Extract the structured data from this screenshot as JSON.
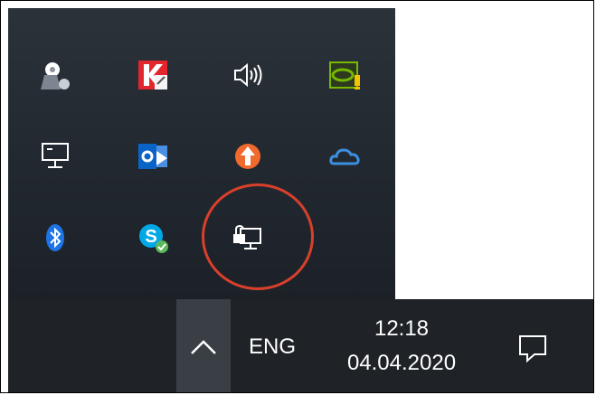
{
  "tray_flyout": {
    "icons": [
      {
        "name": "sound-speaker-icon",
        "row": 0
      },
      {
        "name": "kaspersky-icon",
        "row": 0
      },
      {
        "name": "volume-icon",
        "row": 0
      },
      {
        "name": "nvidia-icon",
        "row": 0
      },
      {
        "name": "network-icon",
        "row": 1
      },
      {
        "name": "outlook-icon",
        "row": 1
      },
      {
        "name": "update-arrow-icon",
        "row": 1
      },
      {
        "name": "onedrive-icon",
        "row": 1
      },
      {
        "name": "bluetooth-icon",
        "row": 2
      },
      {
        "name": "skype-icon",
        "row": 2
      },
      {
        "name": "unlocked-computer-icon",
        "row": 2
      }
    ],
    "highlighted_icon": "unlocked-computer-icon",
    "highlight_color": "#d9402b"
  },
  "taskbar": {
    "language": "ENG",
    "time": "12:18",
    "date": "04.04.2020"
  },
  "colors": {
    "flyout_bg": "#262b32",
    "taskbar_bg": "#1f2328",
    "chevron_bg": "#3a3f45",
    "kaspersky_red": "#e3262d",
    "nvidia_green": "#76b900",
    "outlook_blue": "#0a64c8",
    "update_orange": "#f06a2e",
    "onedrive_blue": "#3c8fe0",
    "bluetooth_blue": "#1e74e6",
    "skype_blue": "#00a8e8"
  }
}
